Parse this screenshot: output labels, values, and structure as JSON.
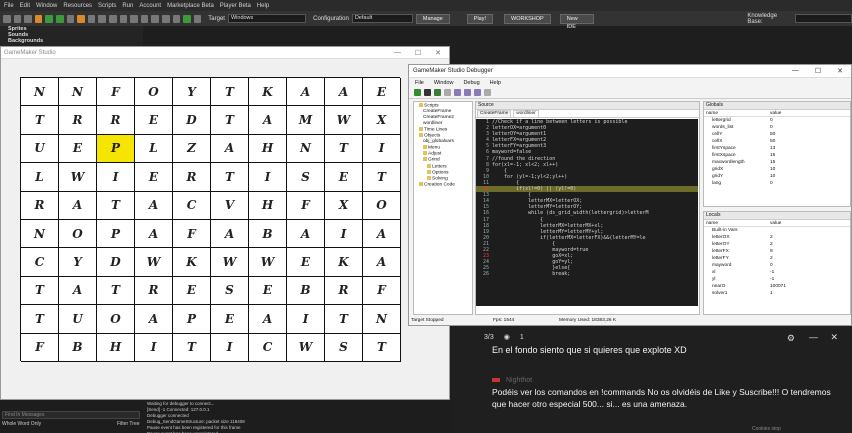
{
  "ide": {
    "menu": [
      "File",
      "Edit",
      "Window",
      "Resources",
      "Scripts",
      "Run",
      "Account",
      "Marketplace Beta",
      "Player Beta",
      "Help"
    ],
    "target_label": "Target",
    "target_value": "Windows",
    "config_label": "Configuration",
    "config_value": "Default",
    "manage_button": "Manage",
    "play_button": "Play!",
    "workshop_button": "WORKSHOP",
    "new_ide_button": "New IDE",
    "kb_label": "Knowledge Base:",
    "resources": [
      "Sprites",
      "Sounds",
      "Backgrounds"
    ]
  },
  "game_window": {
    "title": "GameMaker Studio",
    "controls": [
      "—",
      "☐",
      "✕"
    ],
    "grid": [
      [
        "N",
        "N",
        "F",
        "O",
        "Y",
        "T",
        "K",
        "A",
        "A",
        "E"
      ],
      [
        "T",
        "R",
        "R",
        "E",
        "D",
        "T",
        "A",
        "M",
        "W",
        "X"
      ],
      [
        "U",
        "E",
        "P",
        "L",
        "Z",
        "A",
        "H",
        "N",
        "T",
        "I"
      ],
      [
        "L",
        "W",
        "I",
        "E",
        "R",
        "T",
        "I",
        "S",
        "E",
        "T"
      ],
      [
        "R",
        "A",
        "T",
        "A",
        "C",
        "V",
        "H",
        "F",
        "X",
        "O"
      ],
      [
        "N",
        "O",
        "P",
        "A",
        "F",
        "A",
        "B",
        "A",
        "I",
        "A"
      ],
      [
        "C",
        "Y",
        "D",
        "W",
        "K",
        "W",
        "W",
        "E",
        "K",
        "A"
      ],
      [
        "T",
        "A",
        "T",
        "R",
        "E",
        "S",
        "E",
        "B",
        "R",
        "F"
      ],
      [
        "T",
        "U",
        "O",
        "A",
        "P",
        "E",
        "A",
        "I",
        "T",
        "N"
      ],
      [
        "F",
        "B",
        "H",
        "I",
        "T",
        "I",
        "C",
        "W",
        "S",
        "T"
      ]
    ],
    "selected_row": 2,
    "selected_col": 2,
    "selected_color": "#f6e500"
  },
  "bottom": {
    "find_placeholder": "Find In Messages",
    "whole_word": "Whole Word Only",
    "filter_tree": "Filter Tree",
    "previous": "Previous",
    "next": "Next",
    "log": [
      "Waiting for debugger to connect...",
      "[Send] -1 Connected: 127.0.0.1",
      "Debugger connected",
      "Debug_SendGameStructure: packet size 118408",
      "Pause event has been registered for this frame",
      "Pause event has been unregistered"
    ]
  },
  "debugger": {
    "title": "GameMaker Studio Debugger",
    "controls": [
      "—",
      "☐",
      "✕"
    ],
    "menu": [
      "File",
      "Window",
      "Debug",
      "Help"
    ],
    "tree": [
      {
        "label": "Scripts",
        "indent": 1,
        "folder": true
      },
      {
        "label": "CreateFrame",
        "indent": 2
      },
      {
        "label": "CreateFrame2",
        "indent": 2
      },
      {
        "label": "wordliner",
        "indent": 2
      },
      {
        "label": "Time Lines",
        "indent": 1,
        "folder": true
      },
      {
        "label": "Objects",
        "indent": 1,
        "folder": true
      },
      {
        "label": "obj_globalvars",
        "indent": 2
      },
      {
        "label": "Menu",
        "indent": 2,
        "folder": true
      },
      {
        "label": "Adjust",
        "indent": 2,
        "folder": true
      },
      {
        "label": "Grind",
        "indent": 2,
        "folder": true
      },
      {
        "label": "Letters",
        "indent": 3,
        "folder": true
      },
      {
        "label": "Options",
        "indent": 3,
        "folder": true
      },
      {
        "label": "Solving",
        "indent": 3,
        "folder": true
      },
      {
        "label": "Creation Code",
        "indent": 1,
        "folder": true
      }
    ],
    "source": {
      "title": "Source",
      "tabs": [
        "CreateFrame",
        "wordliner"
      ],
      "active_tab": 1,
      "lines": [
        {
          "n": "1",
          "t": "//Check if a line between letters is possible"
        },
        {
          "n": "2",
          "t": "letterOX=argument0"
        },
        {
          "n": "3",
          "t": "letterOY=argument1"
        },
        {
          "n": "4",
          "t": "letterFX=argument2"
        },
        {
          "n": "5",
          "t": "letterFY=argument3"
        },
        {
          "n": "6",
          "t": "mayword=false"
        },
        {
          "n": "7",
          "t": "//found the direction"
        },
        {
          "n": "8",
          "t": "for(xl=-1; xl<2; xl++)"
        },
        {
          "n": "9",
          "t": "    {"
        },
        {
          "n": "10",
          "t": "    for (yl=-1;yl<2;yl++)"
        },
        {
          "n": "11",
          "t": "        {"
        },
        {
          "n": "12",
          "t": "        if(xl!=0) || (yl!=0)",
          "highlight": true,
          "breakpoint": true
        },
        {
          "n": "13",
          "t": "            {"
        },
        {
          "n": "14",
          "t": "            letterMX=letterOX;"
        },
        {
          "n": "15",
          "t": "            letterMY=letterOY;"
        },
        {
          "n": "16",
          "t": "            while (ds_grid_width(lettergrid)>letterM"
        },
        {
          "n": "17",
          "t": "                {"
        },
        {
          "n": "18",
          "t": "                letterMX=letterMX+xl;"
        },
        {
          "n": "19",
          "t": "                letterMY=letterMY+yl;"
        },
        {
          "n": "20",
          "t": "                if(letterMX=letterFX)&&(letterMY=le"
        },
        {
          "n": "21",
          "t": "                    {"
        },
        {
          "n": "22",
          "t": "                    mayword=true"
        },
        {
          "n": "23",
          "t": "                    goX=xl;",
          "breakpoint": true
        },
        {
          "n": "24",
          "t": "                    goY=yl;"
        },
        {
          "n": "25",
          "t": "                    }else{"
        },
        {
          "n": "26",
          "t": "                    break;"
        }
      ]
    },
    "globals": {
      "title": "Globals",
      "name_col": "name",
      "value_col": "value",
      "rows": [
        {
          "name": "lettergrid",
          "value": "0"
        },
        {
          "name": "words_list",
          "value": "0"
        },
        {
          "name": "cellY",
          "value": "50"
        },
        {
          "name": "cellX",
          "value": "50"
        },
        {
          "name": "firstYspace",
          "value": "13"
        },
        {
          "name": "firstXspace",
          "value": "15"
        },
        {
          "name": "maxwordlength",
          "value": "15"
        },
        {
          "name": "gridX",
          "value": "10"
        },
        {
          "name": "gridY",
          "value": "10"
        },
        {
          "name": "lang",
          "value": "0"
        }
      ]
    },
    "locals": {
      "title": "Locals",
      "name_col": "name",
      "value_col": "value",
      "rows": [
        {
          "name": "Built-in Vars",
          "value": ""
        },
        {
          "name": "letterOX",
          "value": "2"
        },
        {
          "name": "letterOY",
          "value": "2"
        },
        {
          "name": "letterFX",
          "value": "8"
        },
        {
          "name": "letterFY",
          "value": "2"
        },
        {
          "name": "mayword",
          "value": "0"
        },
        {
          "name": "xl",
          "value": "-1"
        },
        {
          "name": "yl",
          "value": "-1"
        },
        {
          "name": "nearO",
          "value": "100071"
        },
        {
          "name": "solver1",
          "value": "1"
        }
      ]
    },
    "status": {
      "state": "Target Stopped",
      "fps": "Fps: 1544",
      "memory": "Memory Used: 18383,26 K"
    }
  },
  "chat": {
    "page": "3/3",
    "viewers": "1",
    "message1": "En el fondo siento que si quieres que explote XD",
    "author2": "Nighthot",
    "message2": "Podéis ver los comandos en !commands No os olvidéis de Like y Suscribe!!! O tendremos que hacer otro especial 500... si... es una amenaza.",
    "footer": "Cookies stop"
  }
}
